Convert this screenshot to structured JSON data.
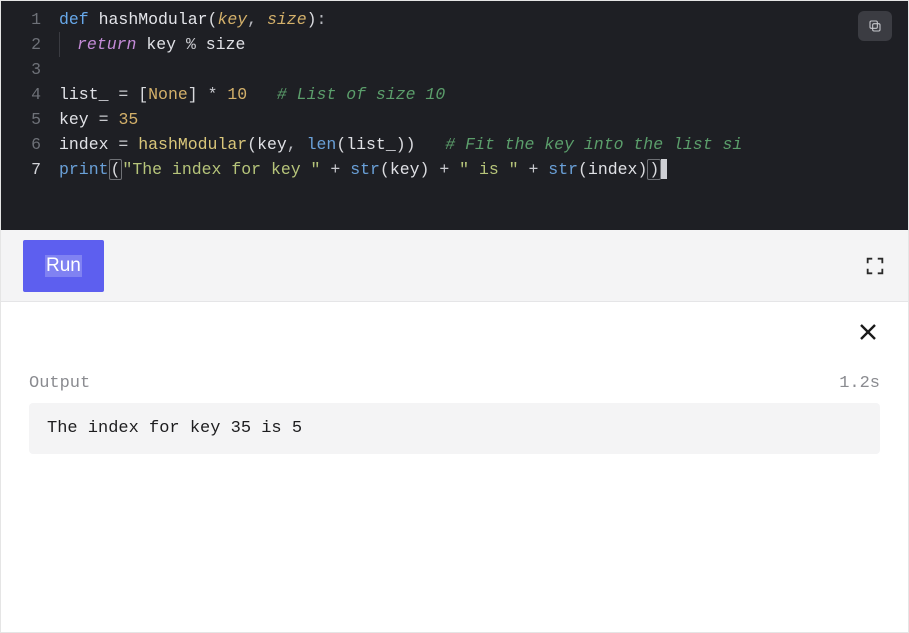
{
  "editor": {
    "lines": [
      {
        "num": "1"
      },
      {
        "num": "2"
      },
      {
        "num": "3"
      },
      {
        "num": "4"
      },
      {
        "num": "5"
      },
      {
        "num": "6"
      },
      {
        "num": "7"
      }
    ],
    "tokens": {
      "def": "def",
      "fn_name": "hashModular",
      "p_key": "key",
      "p_size": "size",
      "return": "return",
      "mod": "%",
      "list_ident": "list_",
      "eq": "=",
      "none": "None",
      "star": "*",
      "ten": "10",
      "c_list": "# List of size 10",
      "key_ident": "key",
      "thirtyfive": "35",
      "index_ident": "index",
      "len": "len",
      "c_fit": "# Fit the key into the list si",
      "print": "print",
      "s_prefix": "\"The index for key \"",
      "plus": "+",
      "str_fn": "str",
      "s_is": "\" is \""
    }
  },
  "toolbar": {
    "run_label": "Run"
  },
  "output": {
    "label": "Output",
    "time": "1.2s",
    "text": "The index for key 35 is 5"
  }
}
